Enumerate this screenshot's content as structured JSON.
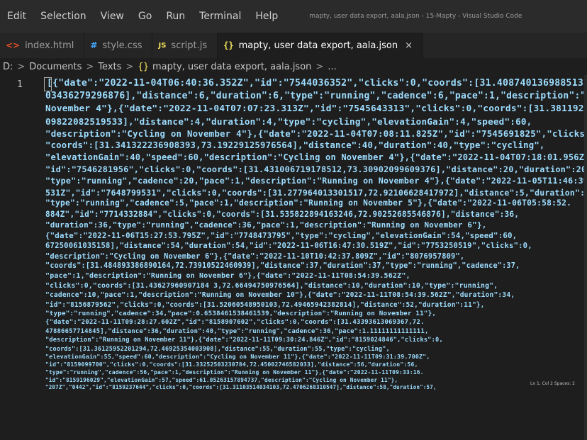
{
  "menubar": {
    "items": [
      "Edit",
      "Selection",
      "View",
      "Go",
      "Run",
      "Terminal",
      "Help"
    ],
    "window_title": "mapty, user data export, aala.json - 15-Mapty - Visual Studio Code"
  },
  "tabs": [
    {
      "icon": "<>",
      "label": "index.html",
      "active": false
    },
    {
      "icon": "#",
      "label": "style.css",
      "active": false
    },
    {
      "icon": "JS",
      "label": "script.js",
      "active": false
    },
    {
      "icon": "{}",
      "label": "mapty, user data export, aala.json",
      "active": true,
      "close": "×"
    }
  ],
  "breadcrumb": {
    "drive": "D:",
    "sep": ">",
    "folder1": "Documents",
    "folder2": "Texts",
    "file_icon": "{}",
    "file": "mapty, user data export, aala.json",
    "more": "..."
  },
  "editor": {
    "line_number": "1",
    "lines": [
      "[{\"date\":\"2022-11-04T06:40:36.352Z\",\"id\":\"7544036352\",\"clicks\":0,\"coords\":[31.408740136988513,73.",
      "03436279296876],\"distance\":6,\"duration\":6,\"type\":\"running\",\"cadence\":6,\"pace\":1,\"description\":\"Running on",
      "November 4\"},{\"date\":\"2022-11-04T07:07:23.313Z\",\"id\":\"7545643313\",\"clicks\":0,\"coords\":[31.38119257971946,73.",
      "09822082519533],\"distance\":4,\"duration\":4,\"type\":\"cycling\",\"elevationGain\":4,\"speed\":60,",
      "\"description\":\"Cycling on November 4\"},{\"date\":\"2022-11-04T07:08:11.825Z\",\"id\":\"7545691825\",\"clicks\":0,",
      "\"coords\":[31.341322236908393,73.19229125976564],\"distance\":40,\"duration\":40,\"type\":\"cycling\",",
      "\"elevationGain\":40,\"speed\":60,\"description\":\"Cycling on November 4\"},{\"date\":\"2022-11-04T07:18:01.956Z\",",
      "\"id\":\"7546281956\",\"clicks\":0,\"coords\":[31.431006719178512,73.30902099609376],\"distance\":20,\"duration\":20,",
      "\"type\":\"running\",\"cadence\":20,\"pace\":1,\"description\":\"Running on November 4\"},{\"date\":\"2022-11-05T11:46:39.",
      "531Z\",\"id\":\"7648799531\",\"clicks\":0,\"coords\":[31.277964013301517,72.92106628417972],\"distance\":5,\"duration\":5,",
      "\"type\":\"running\",\"cadence\":5,\"pace\":1,\"description\":\"Running on November 5\"},{\"date\":\"2022-11-06T05:58:52.",
      "884Z\",\"id\":\"7714332884\",\"clicks\":0,\"coords\":[31.535822894163246,72.90252685546876],\"distance\":36,",
      "\"duration\":36,\"type\":\"running\",\"cadence\":36,\"pace\":1,\"description\":\"Running on November 6\"},",
      "{\"date\":\"2022-11-06T15:27:53.795Z\",\"id\":\"7748473795\",\"type\":\"cycling\",\"elevationGain\":54,\"speed\":60,",
      "67250061035158],\"distance\":54,\"duration\":54,\"id\":\"2022-11-06T16:47:30.519Z\",\"id\":\"7753250519\",\"clicks\":0,",
      "\"description\":\"Cycling on November 6\"},{\"date\":\"2022-11-10T10:42:37.809Z\",\"id\":\"8076957809\",",
      "\"coords\":[31.484893386890164,72.73910522460939],\"distance\":37,\"duration\":37,\"type\":\"running\",\"cadence\":37,",
      "\"pace\":1,\"description\":\"Running on November 6\"},{\"date\":\"2022-11-11T08:54:39.562Z\",",
      "\"clicks\":0,\"coords\":[31.43627960907184 3,72.66494750976564],\"distance\":10,\"duration\":10,\"type\":\"running\",",
      "\"cadence\":10,\"pace\":1,\"description\":\"Running on November 10\"},{\"date\":\"2022-11-11T08:54:39.562Z\",\"duration\":34,",
      "\"id\":\"8156879562\",\"clicks\":0,\"coords\":[31.52060548950103,72.49465942382814],\"distance\":52,\"duration\":11\"},",
      "\"type\":\"running\",\"cadence\":34,\"pace\":0.6538461538461539,\"description\":\"Running on November 11\"},",
      "{\"date\":\"2022-11-11T09:28:27.602Z\",\"id\":\"8158907602\",\"clicks\":0,\"coords\":[31.43393613069367,72.",
      "47886657714845],\"distance\":36,\"duration\":40,\"type\":\"running\",\"cadence\":36,\"pace\":1.11111111111111,",
      "\"description\":\"Running on November 11\"},{\"date\":\"2022-11-11T09:30:24.846Z\",\"id\":\"8159024846\",\"clicks\":0,",
      "\"coords\":[31.36125952201294,72.46925354003908],\"distance\":55,\"duration\":55,\"type\":\"cycling\",",
      "\"elevationGain\":55,\"speed\":60,\"description\":\"Cycling on November 11\"},{\"date\":\"2022-11-11T09:31:39.700Z\",",
      "\"id\":\"8159099700\",\"clicks\":0,\"coords\":[31.33252503230784,72.45002746582033],\"distance\":56,\"duration\":56,",
      "\"type\":\"running\",\"cadence\":56,\"pace\":1,\"description\":\"Running on November 11\"},{\"date\":\"2022-11-11T09:33:16.",
      "\"id\":\"8159196029\",\"elevationGain\":57,\"speed\":61.05263157894737,\"description\":\"Cycling on November 11\"},",
      "\"207Z\",\"0442\",\"id\":\"8159237644\",\"clicks\":0,\"coords\":[31.31103514034103,72.4706268310547],\"distance\":58,\"duration\":57,"
    ]
  },
  "statusbar": {
    "text": "Ln 1, Col 2   Spaces: 2"
  }
}
